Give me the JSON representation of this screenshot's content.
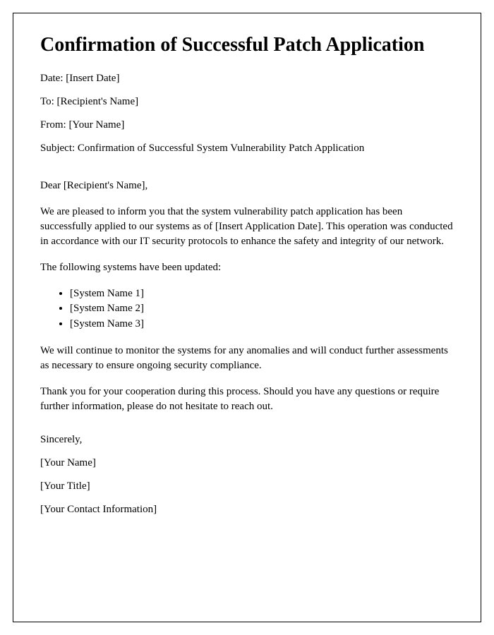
{
  "title": "Confirmation of Successful Patch Application",
  "meta": {
    "date_label": "Date: ",
    "date_value": "[Insert Date]",
    "to_label": "To: ",
    "to_value": "[Recipient's Name]",
    "from_label": "From: ",
    "from_value": "[Your Name]",
    "subject_label": "Subject: ",
    "subject_value": "Confirmation of Successful System Vulnerability Patch Application"
  },
  "salutation": "Dear [Recipient's Name],",
  "body": {
    "p1": "We are pleased to inform you that the system vulnerability patch application has been successfully applied to our systems as of [Insert Application Date]. This operation was conducted in accordance with our IT security protocols to enhance the safety and integrity of our network.",
    "p2": "The following systems have been updated:",
    "systems": [
      "[System Name 1]",
      "[System Name 2]",
      "[System Name 3]"
    ],
    "p3": "We will continue to monitor the systems for any anomalies and will conduct further assessments as necessary to ensure ongoing security compliance.",
    "p4": "Thank you for your cooperation during this process. Should you have any questions or require further information, please do not hesitate to reach out."
  },
  "closing": {
    "signoff": "Sincerely,",
    "name": "[Your Name]",
    "title": "[Your Title]",
    "contact": "[Your Contact Information]"
  }
}
